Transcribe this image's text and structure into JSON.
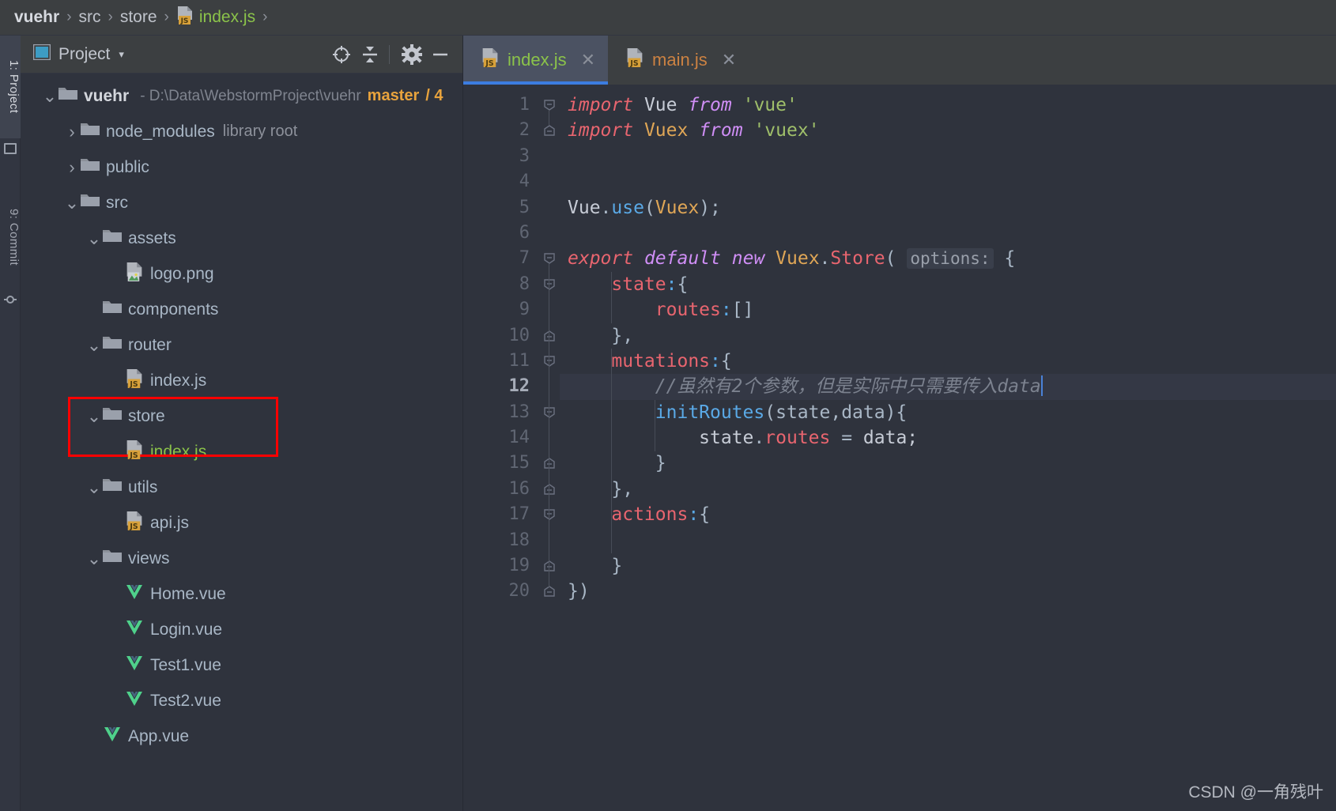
{
  "breadcrumb": {
    "items": [
      {
        "label": "vuehr",
        "kind": "root"
      },
      {
        "label": "src",
        "kind": "dir"
      },
      {
        "label": "store",
        "kind": "dir"
      },
      {
        "label": "index.js",
        "kind": "file",
        "icon": "js-file-icon"
      }
    ],
    "trailing_sep": "›"
  },
  "rail": {
    "project_label": "1: Project",
    "commit_label": "9: Commit"
  },
  "panel": {
    "title": "Project",
    "caret": "▾",
    "buttons": [
      {
        "name": "locate-icon",
        "tooltip": "Select Opened File"
      },
      {
        "name": "collapse-all-icon",
        "tooltip": "Collapse All"
      },
      {
        "name": "gear-icon",
        "tooltip": "Settings"
      },
      {
        "name": "minimize-icon",
        "tooltip": "Hide"
      }
    ]
  },
  "tree": {
    "rows": [
      {
        "twist": "⌄",
        "icon": "folder-icon",
        "name": "vuehr",
        "bold": true,
        "indent": 0,
        "dash": "-",
        "path": "D:\\Data\\WebstormProject\\vuehr",
        "branch": "master",
        "branch_extra": "/ 4"
      },
      {
        "twist": "›",
        "icon": "folder-icon",
        "name": "node_modules",
        "indent": 1,
        "suffix": "library root"
      },
      {
        "twist": "›",
        "icon": "folder-icon",
        "name": "public",
        "indent": 1
      },
      {
        "twist": "⌄",
        "icon": "folder-icon",
        "name": "src",
        "indent": 1
      },
      {
        "twist": "⌄",
        "icon": "folder-icon",
        "name": "assets",
        "indent": 2
      },
      {
        "twist": "",
        "icon": "png-file-icon",
        "name": "logo.png",
        "indent": 3
      },
      {
        "twist": "",
        "icon": "folder-icon",
        "name": "components",
        "indent": 2
      },
      {
        "twist": "⌄",
        "icon": "folder-icon",
        "name": "router",
        "indent": 2
      },
      {
        "twist": "",
        "icon": "js-file-icon",
        "name": "index.js",
        "indent": 3
      },
      {
        "twist": "⌄",
        "icon": "folder-icon",
        "name": "store",
        "indent": 2
      },
      {
        "twist": "",
        "icon": "js-file-icon",
        "name": "index.js",
        "indent": 3,
        "selected": true
      },
      {
        "twist": "⌄",
        "icon": "folder-icon",
        "name": "utils",
        "indent": 2
      },
      {
        "twist": "",
        "icon": "js-file-icon",
        "name": "api.js",
        "indent": 3
      },
      {
        "twist": "⌄",
        "icon": "folder-icon",
        "name": "views",
        "indent": 2
      },
      {
        "twist": "",
        "icon": "vue-file-icon",
        "name": "Home.vue",
        "indent": 3
      },
      {
        "twist": "",
        "icon": "vue-file-icon",
        "name": "Login.vue",
        "indent": 3
      },
      {
        "twist": "",
        "icon": "vue-file-icon",
        "name": "Test1.vue",
        "indent": 3
      },
      {
        "twist": "",
        "icon": "vue-file-icon",
        "name": "Test2.vue",
        "indent": 3
      },
      {
        "twist": "",
        "icon": "vue-file-icon",
        "name": "App.vue",
        "indent": 2
      }
    ]
  },
  "tabs": [
    {
      "label": "index.js",
      "icon": "js-file-icon",
      "active": true,
      "color": "green",
      "close": "✕"
    },
    {
      "label": "main.js",
      "icon": "js-file-icon",
      "active": false,
      "color": "orange",
      "close": "✕"
    }
  ],
  "code": {
    "current_line": 12,
    "total_lines": 20,
    "lines": [
      {
        "n": 1,
        "fold": "minus-circle",
        "tokens": [
          {
            "t": "import",
            "c": "kw-red"
          },
          {
            "t": " ",
            "c": "punc"
          },
          {
            "t": "Vue",
            "c": "plain"
          },
          {
            "t": " ",
            "c": "punc"
          },
          {
            "t": "from",
            "c": "kw2"
          },
          {
            "t": " ",
            "c": "punc"
          },
          {
            "t": "'vue'",
            "c": "str"
          }
        ]
      },
      {
        "n": 2,
        "fold": "minus-end",
        "tokens": [
          {
            "t": "import",
            "c": "kw-red"
          },
          {
            "t": " ",
            "c": "punc"
          },
          {
            "t": "Vuex",
            "c": "cls"
          },
          {
            "t": " ",
            "c": "punc"
          },
          {
            "t": "from",
            "c": "kw2"
          },
          {
            "t": " ",
            "c": "punc"
          },
          {
            "t": "'vuex'",
            "c": "str"
          }
        ]
      },
      {
        "n": 3,
        "fold": "",
        "tokens": []
      },
      {
        "n": 4,
        "fold": "",
        "tokens": []
      },
      {
        "n": 5,
        "fold": "",
        "tokens": [
          {
            "t": "Vue",
            "c": "plain"
          },
          {
            "t": ".",
            "c": "punc"
          },
          {
            "t": "use",
            "c": "fn"
          },
          {
            "t": "(",
            "c": "punc"
          },
          {
            "t": "Vuex",
            "c": "cls"
          },
          {
            "t": ");",
            "c": "punc"
          }
        ]
      },
      {
        "n": 6,
        "fold": "",
        "tokens": []
      },
      {
        "n": 7,
        "fold": "minus-circle",
        "tokens": [
          {
            "t": "export",
            "c": "kw-red"
          },
          {
            "t": " ",
            "c": "punc"
          },
          {
            "t": "default",
            "c": "kw2"
          },
          {
            "t": " ",
            "c": "punc"
          },
          {
            "t": "new",
            "c": "kw2"
          },
          {
            "t": " ",
            "c": "punc"
          },
          {
            "t": "Vuex",
            "c": "cls"
          },
          {
            "t": ".",
            "c": "punc"
          },
          {
            "t": "Store",
            "c": "prop"
          },
          {
            "t": "(",
            "c": "punc"
          },
          {
            "t": " ",
            "c": "punc"
          },
          {
            "t": "options:",
            "c": "hint"
          },
          {
            "t": " {",
            "c": "punc"
          }
        ]
      },
      {
        "n": 8,
        "fold": "minus-circle",
        "tokens": [
          {
            "t": "    ",
            "c": "punc"
          },
          {
            "t": "state",
            "c": "prop"
          },
          {
            "t": ":",
            "c": "colon"
          },
          {
            "t": "{",
            "c": "punc"
          }
        ]
      },
      {
        "n": 9,
        "fold": "",
        "tokens": [
          {
            "t": "        ",
            "c": "punc"
          },
          {
            "t": "routes",
            "c": "prop"
          },
          {
            "t": ":",
            "c": "colon"
          },
          {
            "t": "[]",
            "c": "punc"
          }
        ]
      },
      {
        "n": 10,
        "fold": "minus-end",
        "tokens": [
          {
            "t": "    ",
            "c": "punc"
          },
          {
            "t": "},",
            "c": "punc"
          }
        ]
      },
      {
        "n": 11,
        "fold": "minus-circle",
        "tokens": [
          {
            "t": "    ",
            "c": "punc"
          },
          {
            "t": "mutations",
            "c": "prop"
          },
          {
            "t": ":",
            "c": "colon"
          },
          {
            "t": "{",
            "c": "punc"
          }
        ]
      },
      {
        "n": 12,
        "fold": "",
        "current": true,
        "caret": true,
        "tokens": [
          {
            "t": "        ",
            "c": "punc"
          },
          {
            "t": "//虽然有2个参数，但是实际中只需要传入data",
            "c": "comment"
          }
        ]
      },
      {
        "n": 13,
        "fold": "minus-circle",
        "tokens": [
          {
            "t": "        ",
            "c": "punc"
          },
          {
            "t": "initRoutes",
            "c": "fn"
          },
          {
            "t": "(state,data){",
            "c": "punc"
          }
        ]
      },
      {
        "n": 14,
        "fold": "",
        "tokens": [
          {
            "t": "            ",
            "c": "punc"
          },
          {
            "t": "state",
            "c": "plain"
          },
          {
            "t": ".",
            "c": "punc"
          },
          {
            "t": "routes",
            "c": "prop"
          },
          {
            "t": " = ",
            "c": "punc"
          },
          {
            "t": "data;",
            "c": "plain"
          }
        ]
      },
      {
        "n": 15,
        "fold": "minus-end",
        "tokens": [
          {
            "t": "        ",
            "c": "punc"
          },
          {
            "t": "}",
            "c": "punc"
          }
        ]
      },
      {
        "n": 16,
        "fold": "minus-end",
        "tokens": [
          {
            "t": "    ",
            "c": "punc"
          },
          {
            "t": "},",
            "c": "punc"
          }
        ]
      },
      {
        "n": 17,
        "fold": "minus-circle",
        "tokens": [
          {
            "t": "    ",
            "c": "punc"
          },
          {
            "t": "actions",
            "c": "prop"
          },
          {
            "t": ":",
            "c": "colon"
          },
          {
            "t": "{",
            "c": "punc"
          }
        ]
      },
      {
        "n": 18,
        "fold": "",
        "tokens": []
      },
      {
        "n": 19,
        "fold": "minus-end",
        "tokens": [
          {
            "t": "    ",
            "c": "punc"
          },
          {
            "t": "}",
            "c": "punc"
          }
        ]
      },
      {
        "n": 20,
        "fold": "minus-end",
        "tokens": [
          {
            "t": "})",
            "c": "punc"
          }
        ]
      }
    ]
  },
  "watermark": "CSDN @一角残叶",
  "colors": {
    "accent_blue": "#3c7de0",
    "highlight_red": "#ff0000",
    "js_badge": "#d8a13a",
    "vue_green": "#4fd18b",
    "branch_orange": "#e8a33d",
    "file_green": "#8bc34a",
    "editor_bg": "#2f333d",
    "panel_bg": "#3c3f41"
  }
}
